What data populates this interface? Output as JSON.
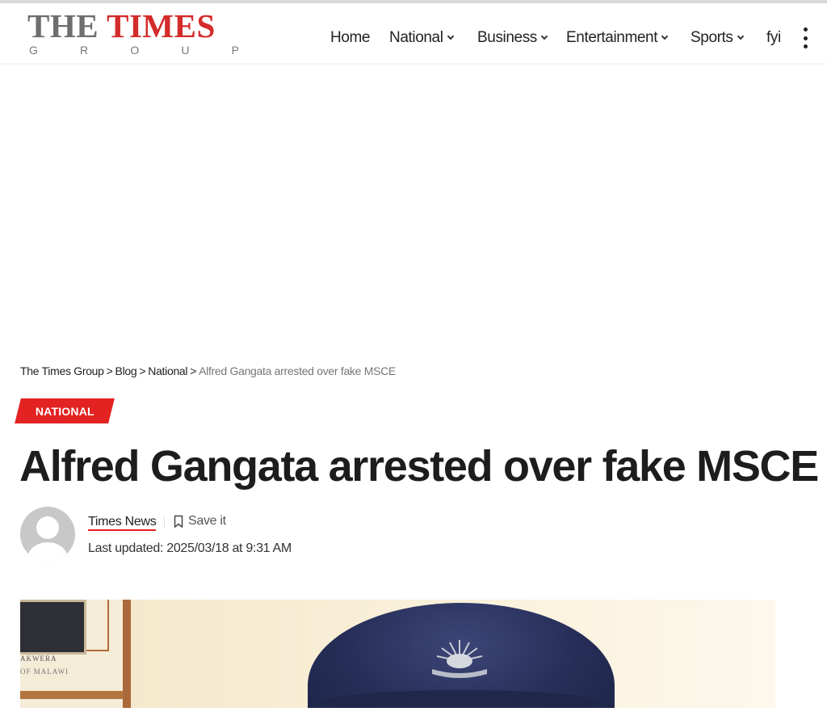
{
  "header": {
    "logo": {
      "the": "THE",
      "times": "TIMES",
      "group": [
        "G",
        "R",
        "O",
        "U",
        "P"
      ]
    },
    "nav": [
      {
        "label": "Home",
        "has_dropdown": false
      },
      {
        "label": "National",
        "has_dropdown": true
      },
      {
        "label": "Business",
        "has_dropdown": true
      },
      {
        "label": "Entertainment",
        "has_dropdown": true
      },
      {
        "label": "Sports",
        "has_dropdown": true
      },
      {
        "label": "fyi",
        "has_dropdown": false
      }
    ],
    "more_icon": "vertical-dots-icon"
  },
  "breadcrumb": {
    "items": [
      "The Times Group",
      "Blog",
      "National"
    ],
    "separator": ">",
    "current": "Alfred Gangata arrested over fake MSCE"
  },
  "article": {
    "category": "NATIONAL",
    "title": "Alfred Gangata arrested over fake MSCE",
    "author": "Times News",
    "save_label": "Save it",
    "save_icon": "bookmark-icon",
    "updated": "Last updated: 2025/03/18 at 9:31 AM",
    "photo": {
      "frame_caption_1": "AKWERA",
      "frame_caption_2": "OF MALAWI"
    }
  },
  "colors": {
    "accent": "#e32222",
    "logo_red": "#d42b2b",
    "logo_gray": "#6e6e6e",
    "text": "#222222"
  }
}
